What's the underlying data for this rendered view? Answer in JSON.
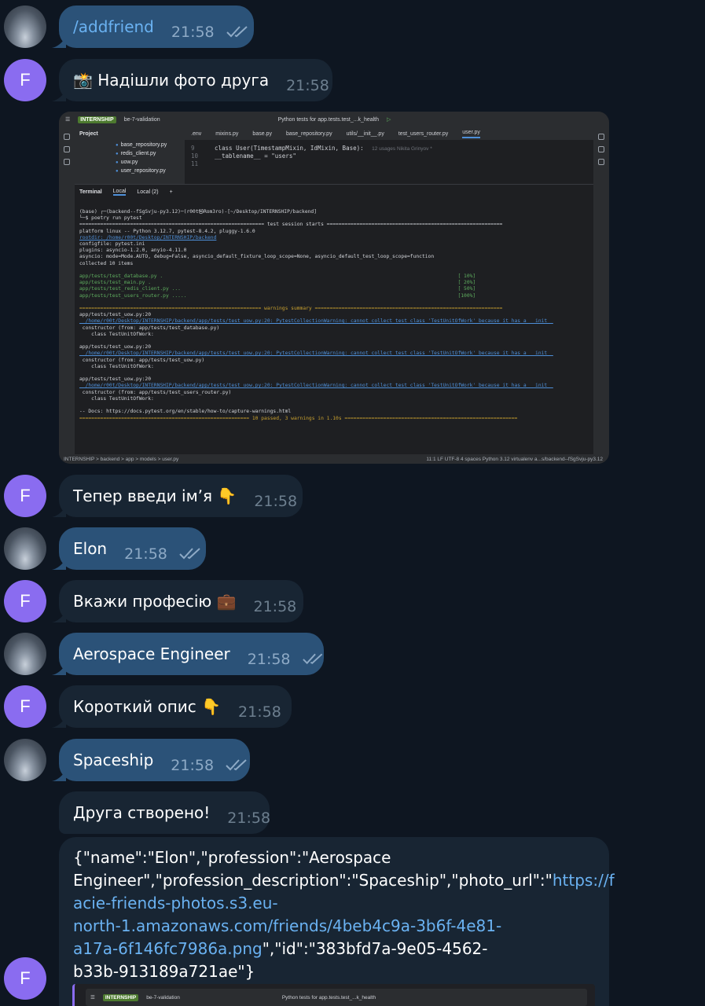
{
  "messages": [
    {
      "id": "m1",
      "dir": "out",
      "text": "/addfriend",
      "time": "21:58"
    },
    {
      "id": "m2",
      "dir": "in",
      "text": "📸 Надішли фото друга",
      "time": "21:58"
    },
    {
      "id": "m3",
      "dir": "in",
      "text": "Тепер введи імʼя 👇",
      "time": "21:58"
    },
    {
      "id": "m4",
      "dir": "out",
      "text": "Elon",
      "time": "21:58"
    },
    {
      "id": "m5",
      "dir": "in",
      "text": "Вкажи професію 💼",
      "time": "21:58"
    },
    {
      "id": "m6",
      "dir": "out",
      "text": "Aerospace Engineer",
      "time": "21:58"
    },
    {
      "id": "m7",
      "dir": "in",
      "text": "Короткий опис 👇",
      "time": "21:58"
    },
    {
      "id": "m8",
      "dir": "out",
      "text": "Spaceship",
      "time": "21:58"
    },
    {
      "id": "m9",
      "dir": "in",
      "text": "Друга створено!",
      "time": "21:58"
    }
  ],
  "avatar_letter": "F",
  "json_message": {
    "line1": "{\"name\":\"Elon\",\"profession\":\"Aerospace",
    "line2_pre": "Engineer\",\"profession_description\":\"Spaceship\",\"photo_url\":\"",
    "line2_link": "https://f",
    "line3_link": "acie-friends-photos.s3.eu-",
    "line4_link": "north-1.amazonaws.com/friends/4beb4c9a-3b6f-4e81-",
    "line5_link": "a17a-6f146fc7986a.png",
    "line5_post": "\",\"id\":\"383bfd7a-9e05-4562-",
    "line6": "b33b-913189a721ae\"}"
  },
  "ide": {
    "project": "INTERNSHIP",
    "branch": "be-7-validation",
    "run_config": "Python tests for app.tests.test_...k_health",
    "project_label": "Project",
    "files": [
      "base_repository.py",
      "redis_client.py",
      "uow.py",
      "user_repository.py"
    ],
    "tabs": [
      ".env",
      "mixins.py",
      "base.py",
      "base_repository.py",
      "utils/__init__.py",
      "test_users_router.py",
      "user.py"
    ],
    "code_line1": "class User(TimestampMixin, IdMixin, Base):",
    "code_usages": "12 usages   Nikita Grinyov *",
    "code_line2": "    __tablename__ = \"users\"",
    "line_nums": [
      "9",
      "10",
      "11"
    ],
    "terminal_tabs": [
      "Terminal",
      "Local",
      "Local (2)"
    ],
    "terminal_lines": [
      "(base) ┌─(backend--fSgSvju-py3.12)─(r00t㉿Rom3ro)-[~/Desktop/INTERNSHIP/backend]",
      "└─$ poetry run pytest",
      "============================================================== test session starts ===========================================================",
      "platform linux -- Python 3.12.7, pytest-8.4.2, pluggy-1.6.0",
      "rootdir: /home/r00t/Desktop/INTERNSHIP/backend",
      "configfile: pytest.ini",
      "plugins: asyncio-1.2.0, anyio-4.11.0",
      "asyncio: mode=Mode.AUTO, debug=False, asyncio_default_fixture_loop_scope=None, asyncio_default_test_loop_scope=function",
      "collected 10 items",
      "",
      "app/tests/test_database.py .                                                                                                   [ 10%]",
      "app/tests/test_main.py .                                                                                                       [ 20%]",
      "app/tests/test_redis_client.py ...                                                                                             [ 50%]",
      "app/tests/test_users_router.py .....                                                                                           [100%]",
      "",
      "============================================================= warnings summary ===============================================================",
      "app/tests/test_uow.py:20",
      "  /home/r00t/Desktop/INTERNSHIP/backend/app/tests/test_uow.py:20: PytestCollectionWarning: cannot collect test class 'TestUnitOfWork' because it has a __init__",
      " constructor (from: app/tests/test_database.py)",
      "    class TestUnitOfWork:",
      "",
      "app/tests/test_uow.py:20",
      "  /home/r00t/Desktop/INTERNSHIP/backend/app/tests/test_uow.py:20: PytestCollectionWarning: cannot collect test class 'TestUnitOfWork' because it has a __init__",
      " constructor (from: app/tests/test_uow.py)",
      "    class TestUnitOfWork:",
      "",
      "app/tests/test_uow.py:20",
      "  /home/r00t/Desktop/INTERNSHIP/backend/app/tests/test_uow.py:20: PytestCollectionWarning: cannot collect test class 'TestUnitOfWork' because it has a __init__",
      " constructor (from: app/tests/test_users_router.py)",
      "    class TestUnitOfWork:",
      "",
      "-- Docs: https://docs.pytest.org/en/stable/how-to/capture-warnings.html",
      "========================================================= 10 passed, 3 warnings in 1.10s =========================================================="
    ],
    "statusbar_path": "INTERNSHIP > backend > app > models > user.py",
    "statusbar_right": "11:1   LF   UTF-8   4 spaces   Python 3.12 virtualenv a...s/backend--fSgSvju-py3.12"
  }
}
